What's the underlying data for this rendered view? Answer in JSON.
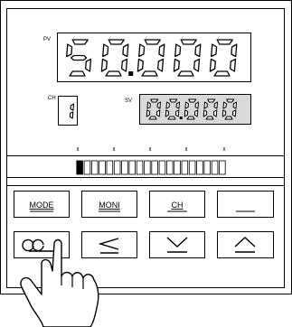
{
  "pv": {
    "label": "PV",
    "value": "50.000"
  },
  "channel": {
    "label": "CH",
    "value": "1"
  },
  "sv": {
    "label": "SV",
    "value": "00.000"
  },
  "bargraph": {
    "filled_segments": 1,
    "total_segments": 20
  },
  "buttons_row1": [
    {
      "label": "MODE"
    },
    {
      "label": "MONI"
    },
    {
      "label": "CH"
    },
    {
      "label": ""
    }
  ],
  "buttons_row2": [
    {
      "icon": "shift-icon"
    },
    {
      "icon": "less-or-equal-icon"
    },
    {
      "icon": "down-arrow-icon"
    },
    {
      "icon": "up-arrow-icon"
    }
  ],
  "colors": {
    "display_bg": "#ffffff",
    "sv_bg": "#d9d9d9",
    "ink": "#000000"
  }
}
